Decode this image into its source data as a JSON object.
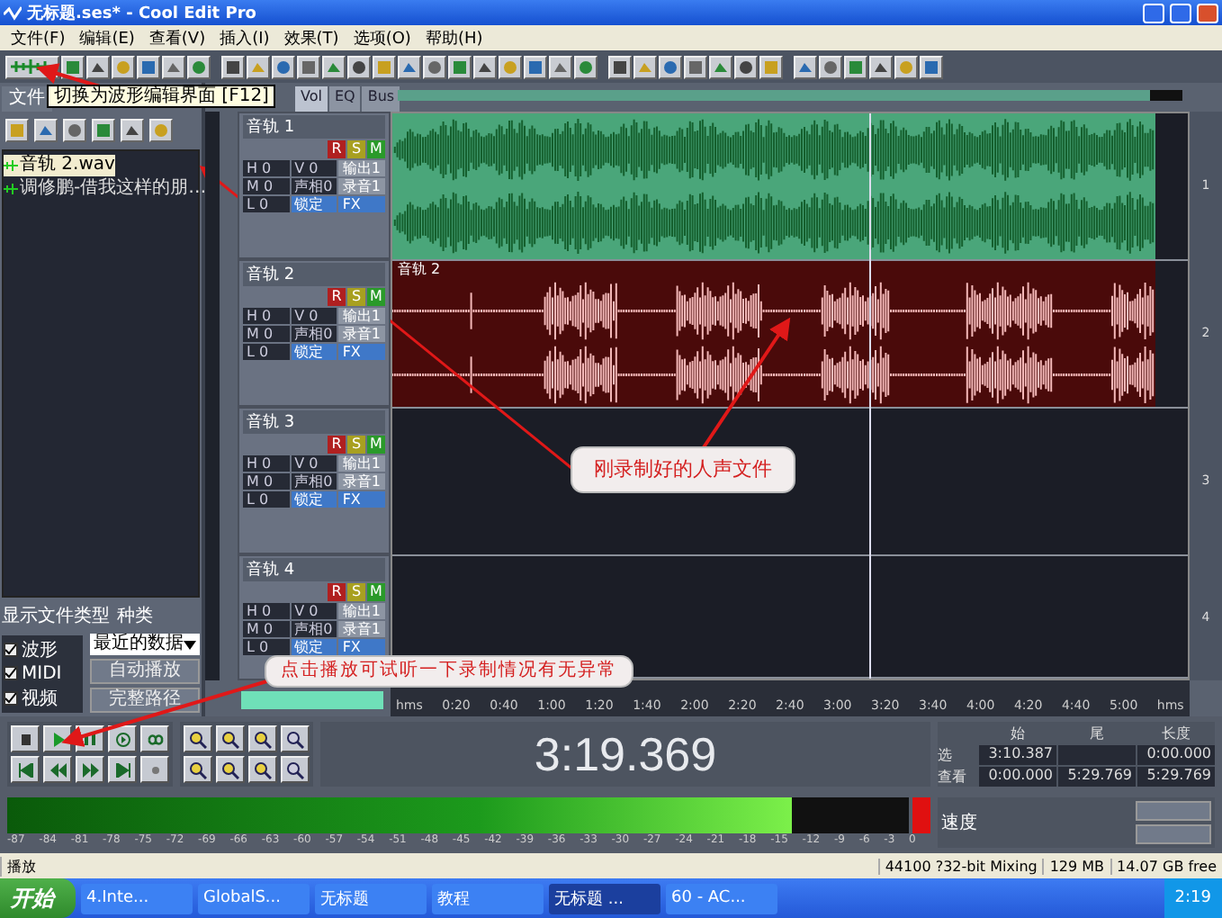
{
  "window": {
    "title": "无标题.ses* - Cool Edit Pro"
  },
  "menu": [
    "文件(F)",
    "编辑(E)",
    "查看(V)",
    "插入(I)",
    "效果(T)",
    "选项(O)",
    "帮助(H)"
  ],
  "tooltip": "切换为波形编辑界面 [F12]",
  "file_panel": {
    "tabs": [
      {
        "label": "文件",
        "selected": true
      }
    ],
    "files": [
      {
        "name": "音轨 2.wav",
        "selected": true
      },
      {
        "name": "调修鹏-借我这样的朋…",
        "selected": false
      }
    ],
    "filter_label": "显示文件类型",
    "sort_label": "种类",
    "types": [
      {
        "label": "波形",
        "checked": true
      },
      {
        "label": "MIDI",
        "checked": true
      },
      {
        "label": "视频",
        "checked": true
      }
    ],
    "sort_value": "最近的数据",
    "buttons": [
      "自动播放",
      "完整路径"
    ]
  },
  "mixer_tabs": [
    {
      "label": "Vol",
      "selected": true
    },
    {
      "label": "EQ",
      "selected": false
    },
    {
      "label": "Bus",
      "selected": false
    }
  ],
  "tracks": [
    {
      "name": "音轨 1",
      "buttons": [
        "R",
        "S",
        "M"
      ],
      "controls": [
        "H 0",
        "V 0",
        "输出1",
        "M 0",
        "声相0",
        "录音1",
        "L 0",
        "锁定",
        "FX"
      ],
      "clip": {
        "kind": "music",
        "color": "#4aa67a"
      }
    },
    {
      "name": "音轨 2",
      "buttons": [
        "R",
        "S",
        "M"
      ],
      "controls": [
        "H 0",
        "V 0",
        "输出1",
        "M 0",
        "声相0",
        "录音1",
        "L 0",
        "锁定",
        "FX"
      ],
      "clip": {
        "kind": "vocal",
        "label": "音轨 2",
        "color": "#4a0a0a"
      }
    },
    {
      "name": "音轨 3",
      "buttons": [
        "R",
        "S",
        "M"
      ],
      "controls": [
        "H 0",
        "V 0",
        "输出1",
        "M 0",
        "声相0",
        "录音1",
        "L 0",
        "锁定",
        "FX"
      ]
    },
    {
      "name": "音轨 4",
      "buttons": [
        "R",
        "S",
        "M"
      ],
      "controls": [
        "H 0",
        "V 0",
        "输出1",
        "M 0",
        "声相0",
        "录音1",
        "L 0",
        "锁定",
        "FX"
      ]
    }
  ],
  "track_numbers": [
    "1",
    "2",
    "3",
    "4"
  ],
  "ruler": [
    "hms",
    "0:20",
    "0:40",
    "1:00",
    "1:20",
    "1:40",
    "2:00",
    "2:20",
    "2:40",
    "3:00",
    "3:20",
    "3:40",
    "4:00",
    "4:20",
    "4:40",
    "5:00",
    "hms"
  ],
  "time": "3:19.369",
  "selection": {
    "columns": [
      "始",
      "尾",
      "长度"
    ],
    "rows": [
      {
        "label": "选",
        "start": "3:10.387",
        "length": "0:00.000"
      },
      {
        "label": "查看",
        "start": "0:00.000",
        "end": "5:29.769",
        "length": "5:29.769"
      }
    ]
  },
  "meter": {
    "level": 0.87,
    "scale": [
      "-87",
      "-84",
      "-81",
      "-78",
      "-75",
      "-72",
      "-69",
      "-66",
      "-63",
      "-60",
      "-57",
      "-54",
      "-51",
      "-48",
      "-45",
      "-42",
      "-39",
      "-36",
      "-33",
      "-30",
      "-27",
      "-24",
      "-21",
      "-18",
      "-15",
      "-12",
      "-9",
      "-6",
      "-3",
      "0"
    ]
  },
  "tempo_label": "速度",
  "status": [
    "播放",
    "44100 ?32-bit Mixing",
    "129 MB",
    "14.07 GB free"
  ],
  "taskbar": {
    "start": "开始",
    "tasks": [
      {
        "label": "4.Inte...",
        "selected": false
      },
      {
        "label": "GlobalS...",
        "selected": false
      },
      {
        "label": "无标题",
        "selected": false
      },
      {
        "label": "教程",
        "selected": false
      },
      {
        "label": "无标题 ...",
        "selected": true
      },
      {
        "label": "60 - AC...",
        "selected": false
      }
    ],
    "clock": "2:19"
  },
  "callouts": [
    "刚录制好的人声文件",
    "点击播放可试听一下录制情况有无异常"
  ]
}
